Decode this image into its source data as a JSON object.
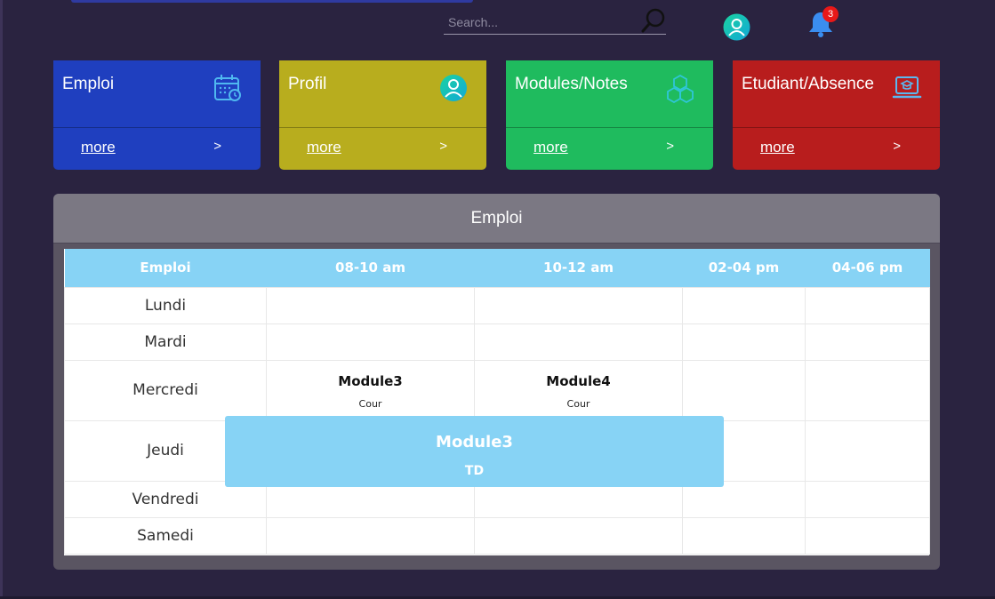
{
  "colors": {
    "background": "#2a2340",
    "card_emploi": "#1f3fbf",
    "card_profil": "#b8ad1e",
    "card_modules": "#1fbb5e",
    "card_etudiant": "#b81d1d",
    "table_header": "#87d3f5",
    "badge": "#e81818"
  },
  "header": {
    "search_placeholder": "Search...",
    "notifications_count": "3"
  },
  "cards": [
    {
      "title": "Emploi",
      "more": "more",
      "arrow": ">",
      "icon": "calendar-clock-icon"
    },
    {
      "title": "Profil",
      "more": "more",
      "arrow": ">",
      "icon": "user-avatar-icon"
    },
    {
      "title": "Modules/Notes",
      "more": "more",
      "arrow": ">",
      "icon": "cubes-icon"
    },
    {
      "title": "Etudiant/Absence",
      "more": "more",
      "arrow": ">",
      "icon": "laptop-graduate-icon"
    }
  ],
  "panel": {
    "title": "Emploi"
  },
  "schedule": {
    "columns": [
      "Emploi",
      "08-10 am",
      "10-12 am",
      "02-04 pm",
      "04-06 pm"
    ],
    "days": [
      "Lundi",
      "Mardi",
      "Mercredi",
      "Jeudi",
      "Vendredi",
      "Samedi"
    ],
    "mercredi": [
      {
        "name": "Module3",
        "type": "Cour"
      },
      {
        "name": "Module4",
        "type": "Cour"
      }
    ],
    "jeudi_overlay": {
      "name": "Module3",
      "type": "TD"
    }
  }
}
